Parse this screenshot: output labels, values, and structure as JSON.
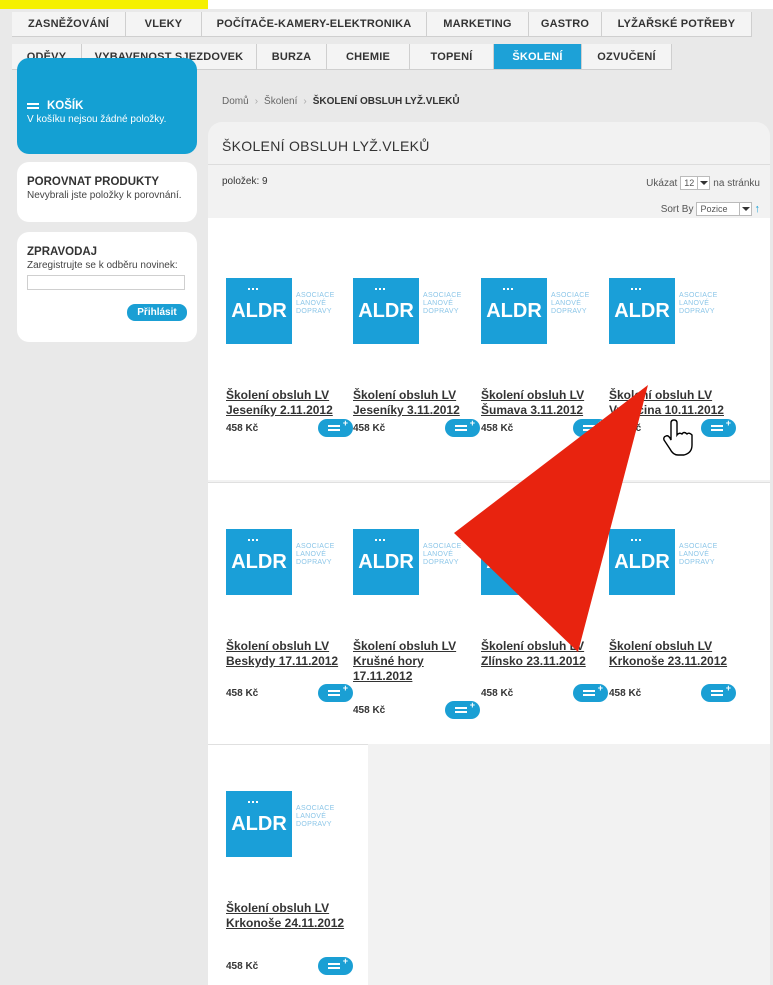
{
  "nav": {
    "row1": [
      "ZASNĚŽOVÁNÍ",
      "VLEKY",
      "POČÍTAČE-KAMERY-ELEKTRONIKA",
      "MARKETING",
      "GASTRO",
      "LYŽAŘSKÉ POTŘEBY"
    ],
    "row2": [
      "ODĚVY",
      "VYBAVENOST SJEZDOVEK",
      "BURZA",
      "CHEMIE",
      "TOPENÍ",
      "ŠKOLENÍ",
      "OZVUČENÍ"
    ],
    "active": "ŠKOLENÍ"
  },
  "sidebar": {
    "cart": {
      "title": "KOŠÍK",
      "text": "V košíku nejsou žádné položky."
    },
    "compare": {
      "title": "POROVNAT PRODUKTY",
      "text": "Nevybrali jste položky k porovnání."
    },
    "newsletter": {
      "title": "ZPRAVODAJ",
      "text": "Zaregistrujte se k odběru novinek:",
      "input_value": "",
      "button": "Přihlásit"
    }
  },
  "breadcrumb": {
    "home": "Domů",
    "section": "Školení",
    "current": "ŠKOLENÍ OBSLUH LYŽ.VLEKŮ"
  },
  "main": {
    "title": "ŠKOLENÍ OBSLUH LYŽ.VLEKŮ",
    "count_label": "položek: 9",
    "show_label": "Ukázat",
    "per_page": "12",
    "per_page_suffix": "na stránku",
    "sort_label": "Sort By",
    "sort_value": "Pozice"
  },
  "logo": {
    "mark": "ALDR",
    "line1": "ASOCIACE",
    "line2": "LANOVÉ",
    "line3": "DOPRAVY"
  },
  "products": [
    {
      "name": "Školení obsluh LV Jeseníky 2.11.2012",
      "price": "458 Kč"
    },
    {
      "name": "Školení obsluh LV Jeseníky 3.11.2012",
      "price": "458 Kč"
    },
    {
      "name": "Školení obsluh LV Šumava 3.11.2012",
      "price": "458 Kč"
    },
    {
      "name": "Školení obsluh LV Vysočina 10.11.2012",
      "price": "458 Kč"
    },
    {
      "name": "Školení obsluh LV Beskydy 17.11.2012",
      "price": "458 Kč"
    },
    {
      "name": "Školení obsluh LV Krušné hory 17.11.2012",
      "price": "458 Kč"
    },
    {
      "name": "Školení obsluh LV Zlínsko 23.11.2012",
      "price": "458 Kč"
    },
    {
      "name": "Školení obsluh LV Krkonoše 23.11.2012",
      "price": "458 Kč"
    },
    {
      "name": "Školení obsluh LV Krkonoše 24.11.2012",
      "price": "458 Kč"
    }
  ],
  "colors": {
    "accent": "#1a9fd4",
    "highlight": "#f5f000",
    "arrow": "#e8230f"
  }
}
